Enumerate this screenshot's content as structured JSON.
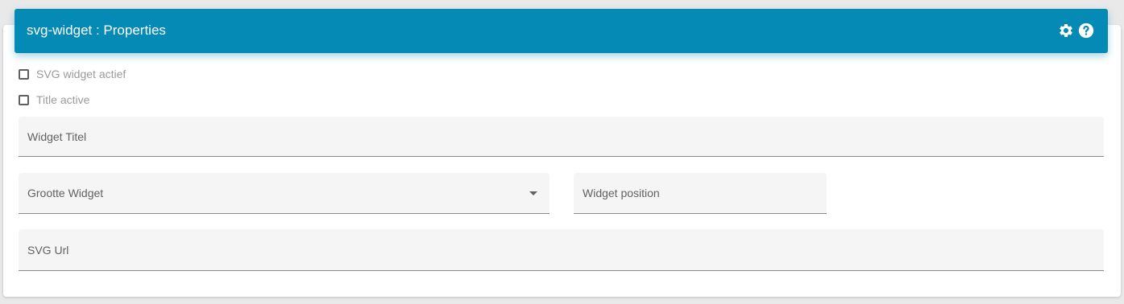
{
  "header": {
    "title": "svg-widget : Properties",
    "background_color": "#058ab5",
    "icons": [
      "gear-icon",
      "help-icon"
    ]
  },
  "checkboxes": [
    {
      "label": "SVG widget actief",
      "checked": false
    },
    {
      "label": "Title active",
      "checked": false
    }
  ],
  "fields": {
    "widget_title": {
      "label": "Widget Titel",
      "value": ""
    },
    "widget_size": {
      "label": "Grootte Widget",
      "value": "",
      "type": "select"
    },
    "widget_position": {
      "label": "Widget position",
      "value": ""
    },
    "svg_url": {
      "label": "SVG Url",
      "value": ""
    }
  }
}
